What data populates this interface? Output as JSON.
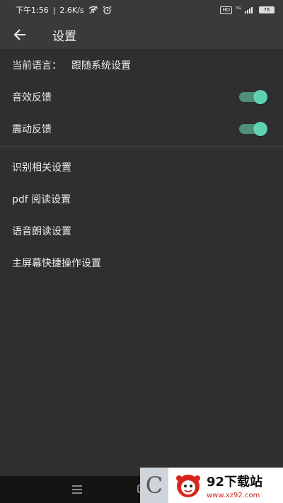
{
  "status_bar": {
    "time": "下午1:56",
    "speed": "2.6K/s",
    "network": "5G",
    "battery": "76"
  },
  "app_bar": {
    "title": "设置"
  },
  "settings": {
    "language_label": "当前语言：",
    "language_value": "跟随系统设置",
    "sound_feedback": "音效反馈",
    "sound_feedback_on": true,
    "vibration_feedback": "震动反馈",
    "vibration_feedback_on": true,
    "items": [
      "识别相关设置",
      "pdf 阅读设置",
      "语音朗读设置",
      "主屏幕快捷操作设置"
    ]
  },
  "colors": {
    "background": "#2f2f2f",
    "app_bar": "#3a3a3a",
    "toggle_track": "#4f8e78",
    "toggle_knob": "#5fd3b1"
  },
  "watermark": {
    "title": "92下载站",
    "url": "www.xz92.com"
  }
}
